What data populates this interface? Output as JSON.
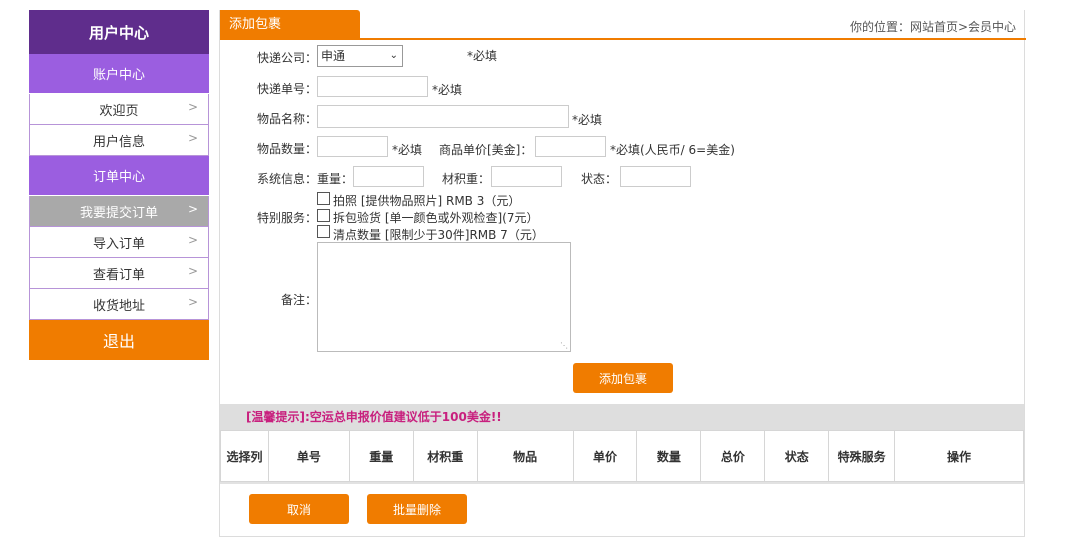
{
  "sidebar": {
    "title": "用户中心",
    "sections": [
      {
        "label": "账户中心"
      },
      {
        "label": "订单中心"
      }
    ],
    "account_items": [
      {
        "label": "欢迎页"
      },
      {
        "label": "用户信息"
      }
    ],
    "order_items": [
      {
        "label": "我要提交订单",
        "active": true
      },
      {
        "label": "导入订单"
      },
      {
        "label": "查看订单"
      },
      {
        "label": "收货地址"
      }
    ],
    "arrow": ">",
    "logout": "退出"
  },
  "header": {
    "tab_title": "添加包裹",
    "breadcrumb": "你的位置：网站首页>会员中心"
  },
  "form": {
    "courier_label": "快递公司：",
    "courier_value": "申通",
    "courier_req": "*必填",
    "tracking_label": "快递单号：",
    "tracking_value": "",
    "tracking_req": "*必填",
    "item_name_label": "物品名称：",
    "item_name_value": "",
    "item_name_req": "*必填",
    "qty_label": "物品数量：",
    "qty_value": "",
    "qty_req": "*必填",
    "unit_price_label": "商品单价[美金]：",
    "unit_price_value": "",
    "unit_price_req": "*必填(人民币/ 6=美金)",
    "sysinfo_label": "系统信息：",
    "weight_label": "重量：",
    "weight_value": "",
    "volume_label": "材积重：",
    "volume_value": "",
    "status_label": "状态：",
    "status_value": "",
    "special_label": "特别服务：",
    "services": [
      {
        "label": "拍照 [提供物品照片] RMB 3（元）",
        "checked": false
      },
      {
        "label": "拆包验货 [单一颜色或外观检查](7元）",
        "checked": false
      },
      {
        "label": "清点数量 [限制少于30件]RMB 7（元）",
        "checked": false
      }
    ],
    "remark_label": "备注：",
    "remark_value": "",
    "submit": "添加包裹"
  },
  "notice": "[温馨提示]:空运总申报价值建议低于100美金!!",
  "table": {
    "columns": [
      "选择列",
      "单号",
      "重量",
      "材积重",
      "物品",
      "单价",
      "数量",
      "总价",
      "状态",
      "特殊服务",
      "操作"
    ],
    "rows": []
  },
  "actions": {
    "cancel": "取消",
    "batch_delete": "批量删除"
  },
  "colors": {
    "brand_purple": "#5f2d8c",
    "section_purple": "#9b5ee0",
    "accent_orange": "#f07c00",
    "notice_magenta": "#c8207e"
  }
}
